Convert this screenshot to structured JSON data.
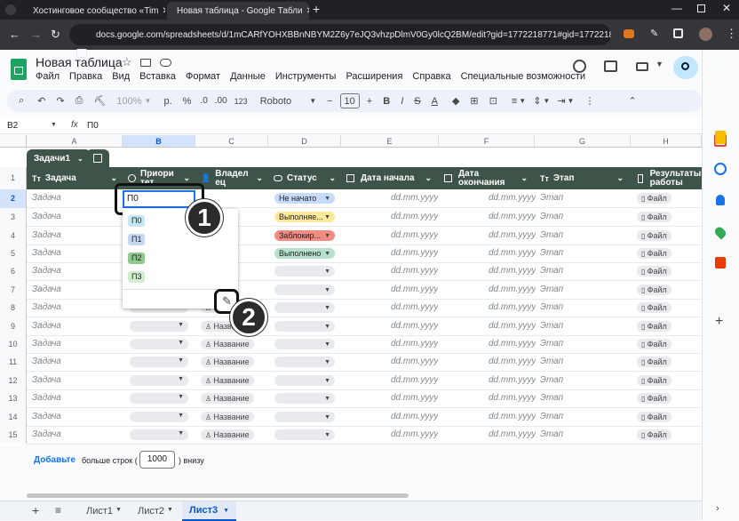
{
  "browser": {
    "tabs": [
      {
        "title": "Хостинговое сообщество «Tim"
      },
      {
        "title": "Новая таблица - Google Табли"
      }
    ],
    "url": "docs.google.com/spreadsheets/d/1mCARfYOHXBBnNBYM2Z6y7eJQ3vhzpDlmV0Gy0lcQ2BM/edit?gid=1772218771#gid=1772218771"
  },
  "sheets": {
    "title": "Новая таблица",
    "menu": [
      "Файл",
      "Правка",
      "Вид",
      "Вставка",
      "Формат",
      "Данные",
      "Инструменты",
      "Расширения",
      "Справка",
      "Специальные возможности"
    ],
    "toolbar": {
      "zoom": "100%",
      "currency": "р.",
      "percent": "%",
      "decimals": ".0",
      "decimals2": ".00",
      "format123": "123",
      "font": "Roboto",
      "font_size": "10"
    },
    "cell_ref": "B2",
    "formula_value": "П0",
    "columns": [
      "A",
      "B",
      "C",
      "D",
      "E",
      "F",
      "G",
      "H"
    ],
    "table_name": "Задачи1",
    "headers": {
      "task_prefix": "Тт",
      "task": "Задача",
      "priority": "Приори тет",
      "owner": "Владел ец",
      "status": "Статус",
      "start": "Дата начала",
      "end": "Дата окончания",
      "stage_prefix": "Тт",
      "stage": "Этап",
      "results": "Результаты работы"
    },
    "row_numbers": [
      "1",
      "2",
      "3",
      "4",
      "5",
      "6",
      "7",
      "8",
      "9",
      "10",
      "11",
      "12",
      "13",
      "14",
      "15"
    ],
    "rows": [
      {
        "task": "Задача",
        "status": "Не начато",
        "owner": "",
        "date1": "dd.mm.yyyy",
        "date2": "dd.mm.yyyy",
        "stage": "Этап",
        "file": "Файл"
      },
      {
        "task": "Задача",
        "status": "Выполняе...",
        "owner": "",
        "date1": "dd.mm.yyyy",
        "date2": "dd.mm.yyyy",
        "stage": "Этап",
        "file": "Файл"
      },
      {
        "task": "Задача",
        "status": "Заблокир...",
        "owner": "",
        "date1": "dd.mm.yyyy",
        "date2": "dd.mm.yyyy",
        "stage": "Этап",
        "file": "Файл"
      },
      {
        "task": "Задача",
        "status": "Выполнено",
        "owner": "",
        "date1": "dd.mm.yyyy",
        "date2": "dd.mm.yyyy",
        "stage": "Этап",
        "file": "Файл"
      },
      {
        "task": "Задача",
        "status": "",
        "owner": "",
        "date1": "dd.mm.yyyy",
        "date2": "dd.mm.yyyy",
        "stage": "Этап",
        "file": "Файл"
      },
      {
        "task": "Задача",
        "status": "",
        "owner": "",
        "date1": "dd.mm.yyyy",
        "date2": "dd.mm.yyyy",
        "stage": "Этап",
        "file": "Файл"
      },
      {
        "task": "Задача",
        "status": "",
        "owner": "Название",
        "date1": "dd.mm.yyyy",
        "date2": "dd.mm.yyyy",
        "stage": "Этап",
        "file": "Файл"
      },
      {
        "task": "Задача",
        "status": "",
        "owner": "Название",
        "date1": "dd.mm.yyyy",
        "date2": "dd.mm.yyyy",
        "stage": "Этап",
        "file": "Файл"
      },
      {
        "task": "Задача",
        "status": "",
        "owner": "Название",
        "date1": "dd.mm.yyyy",
        "date2": "dd.mm.yyyy",
        "stage": "Этап",
        "file": "Файл"
      },
      {
        "task": "Задача",
        "status": "",
        "owner": "Название",
        "date1": "dd.mm.yyyy",
        "date2": "dd.mm.yyyy",
        "stage": "Этап",
        "file": "Файл"
      },
      {
        "task": "Задача",
        "status": "",
        "owner": "Название",
        "date1": "dd.mm.yyyy",
        "date2": "dd.mm.yyyy",
        "stage": "Этап",
        "file": "Файл"
      },
      {
        "task": "Задача",
        "status": "",
        "owner": "Название",
        "date1": "dd.mm.yyyy",
        "date2": "dd.mm.yyyy",
        "stage": "Этап",
        "file": "Файл"
      },
      {
        "task": "Задача",
        "status": "",
        "owner": "Название",
        "date1": "dd.mm.yyyy",
        "date2": "dd.mm.yyyy",
        "stage": "Этап",
        "file": "Файл"
      },
      {
        "task": "Задача",
        "status": "",
        "owner": "Название",
        "date1": "dd.mm.yyyy",
        "date2": "dd.mm.yyyy",
        "stage": "Этап",
        "file": "Файл"
      }
    ],
    "status_colors": {
      "Не начато": "#c6dbf9",
      "Выполняе...": "#fde99a",
      "Заблокир...": "#f28b82",
      "Выполнено": "#b7e1cd"
    },
    "editing_cell_value": "П0",
    "dropdown_options": [
      {
        "label": "П0",
        "color": "#c7e8f0"
      },
      {
        "label": "П1",
        "color": "#c6d5f0"
      },
      {
        "label": "П2",
        "color": "#8fc98f"
      },
      {
        "label": "П3",
        "color": "#d2ecd0"
      }
    ],
    "callouts": [
      "1",
      "2"
    ],
    "add_more": {
      "button": "Добавьте",
      "text_before": "больше строк (",
      "count": "1000",
      "text_after": ") внизу"
    },
    "sheet_tabs": [
      "Лист1",
      "Лист2",
      "Лист3"
    ],
    "active_sheet": "Лист3"
  }
}
